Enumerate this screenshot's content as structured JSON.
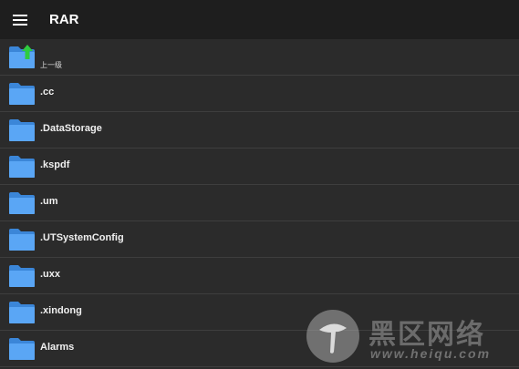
{
  "app": {
    "title": "RAR",
    "menu_icon": "hamburger-menu-icon"
  },
  "colors": {
    "topbar": "#1e1e1e",
    "background": "#2b2b2b",
    "folder": "#5aa6f5",
    "folder_dark": "#3b86d8",
    "up_arrow": "#2ecc40"
  },
  "list": {
    "parent": {
      "label": "上一级",
      "icon": "folder-up-icon"
    },
    "items": [
      {
        "label": ".cc",
        "icon": "folder-icon"
      },
      {
        "label": ".DataStorage",
        "icon": "folder-icon"
      },
      {
        "label": ".kspdf",
        "icon": "folder-icon"
      },
      {
        "label": ".um",
        "icon": "folder-icon"
      },
      {
        "label": ".UTSystemConfig",
        "icon": "folder-icon"
      },
      {
        "label": ".uxx",
        "icon": "folder-icon"
      },
      {
        "label": ".xindong",
        "icon": "folder-icon"
      },
      {
        "label": "Alarms",
        "icon": "folder-icon"
      }
    ]
  },
  "watermark": {
    "text": "黑区网络",
    "url": "www.heiqu.com"
  }
}
